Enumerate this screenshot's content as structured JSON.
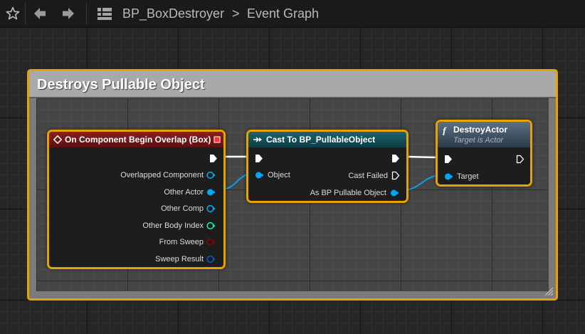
{
  "toolbar": {
    "favorite_icon": "star-icon",
    "back_icon": "arrow-left-icon",
    "forward_icon": "arrow-right-icon",
    "blueprint_icon": "blueprint-grid-icon"
  },
  "breadcrumb": {
    "asset": "BP_BoxDestroyer",
    "separator": ">",
    "graph": "Event Graph"
  },
  "comment": {
    "title": "Destroys Pullable Object",
    "color": "#a9a9a9"
  },
  "nodes": {
    "event": {
      "title": "On Component Begin Overlap (Box)",
      "header_color": "#7a1a1a",
      "pins": [
        {
          "label": "Overlapped Component",
          "color": "#00a8f4",
          "connected": false
        },
        {
          "label": "Other Actor",
          "color": "#00a8f4",
          "connected": true
        },
        {
          "label": "Other Comp",
          "color": "#00a8f4",
          "connected": false
        },
        {
          "label": "Other Body Index",
          "color": "#1fe3af",
          "connected": false
        },
        {
          "label": "From Sweep",
          "color": "#950000",
          "connected": false
        },
        {
          "label": "Sweep Result",
          "color": "#0059cb",
          "connected": false
        }
      ]
    },
    "cast": {
      "title": "Cast To BP_PullableObject",
      "header_color": "#14505a",
      "input_pin": "Object",
      "output_fail": "Cast Failed",
      "output_object": "As BP Pullable Object"
    },
    "destroy": {
      "title": "DestroyActor",
      "subtitle": "Target is Actor",
      "header_color": "#465a6e",
      "input_pin": "Target"
    }
  },
  "colors": {
    "selection": "#e8a200",
    "object_pin": "#00a8f4",
    "exec_pin": "#ffffff"
  }
}
